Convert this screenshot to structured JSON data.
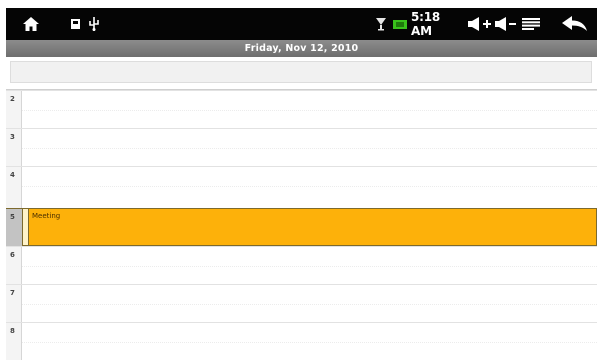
{
  "status_bar": {
    "time": "5:18 AM",
    "icons": [
      "home-icon",
      "sd-card-icon",
      "usb-icon",
      "wifi-icon",
      "battery-icon",
      "volume-up-icon",
      "volume-down-icon",
      "menu-icon",
      "back-icon"
    ]
  },
  "calendar": {
    "date_title": "Friday, Nov 12, 2010",
    "hours": [
      "2",
      "3",
      "4",
      "5",
      "6",
      "7",
      "8"
    ],
    "events": [
      {
        "title": "Meeting",
        "start_hour": "5",
        "color": "#fdb10a"
      }
    ]
  },
  "colors": {
    "status_bar": "#050505",
    "date_header": "#7d7d7d",
    "event": "#fdb10a"
  }
}
